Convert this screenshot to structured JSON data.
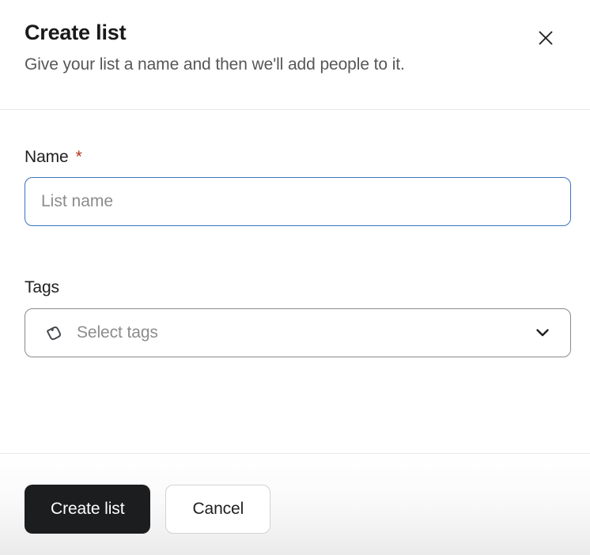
{
  "modal": {
    "title": "Create list",
    "subtitle": "Give your list a name and then we'll add people to it."
  },
  "form": {
    "name": {
      "label": "Name",
      "required_marker": "*",
      "value": "",
      "placeholder": "List name"
    },
    "tags": {
      "label": "Tags",
      "placeholder": "Select tags"
    }
  },
  "footer": {
    "create_label": "Create list",
    "cancel_label": "Cancel"
  },
  "icons": {
    "close": "close-icon",
    "tag": "tag-icon",
    "chevron_down": "chevron-down-icon"
  },
  "colors": {
    "focus_border": "#3b72c0",
    "required_asterisk": "#b5331f",
    "primary_button_bg": "#1c1d1f",
    "primary_button_text": "#ffffff",
    "divider": "#e8e8e8",
    "placeholder_text": "#8c8c8c",
    "subtitle_text": "#575757"
  }
}
